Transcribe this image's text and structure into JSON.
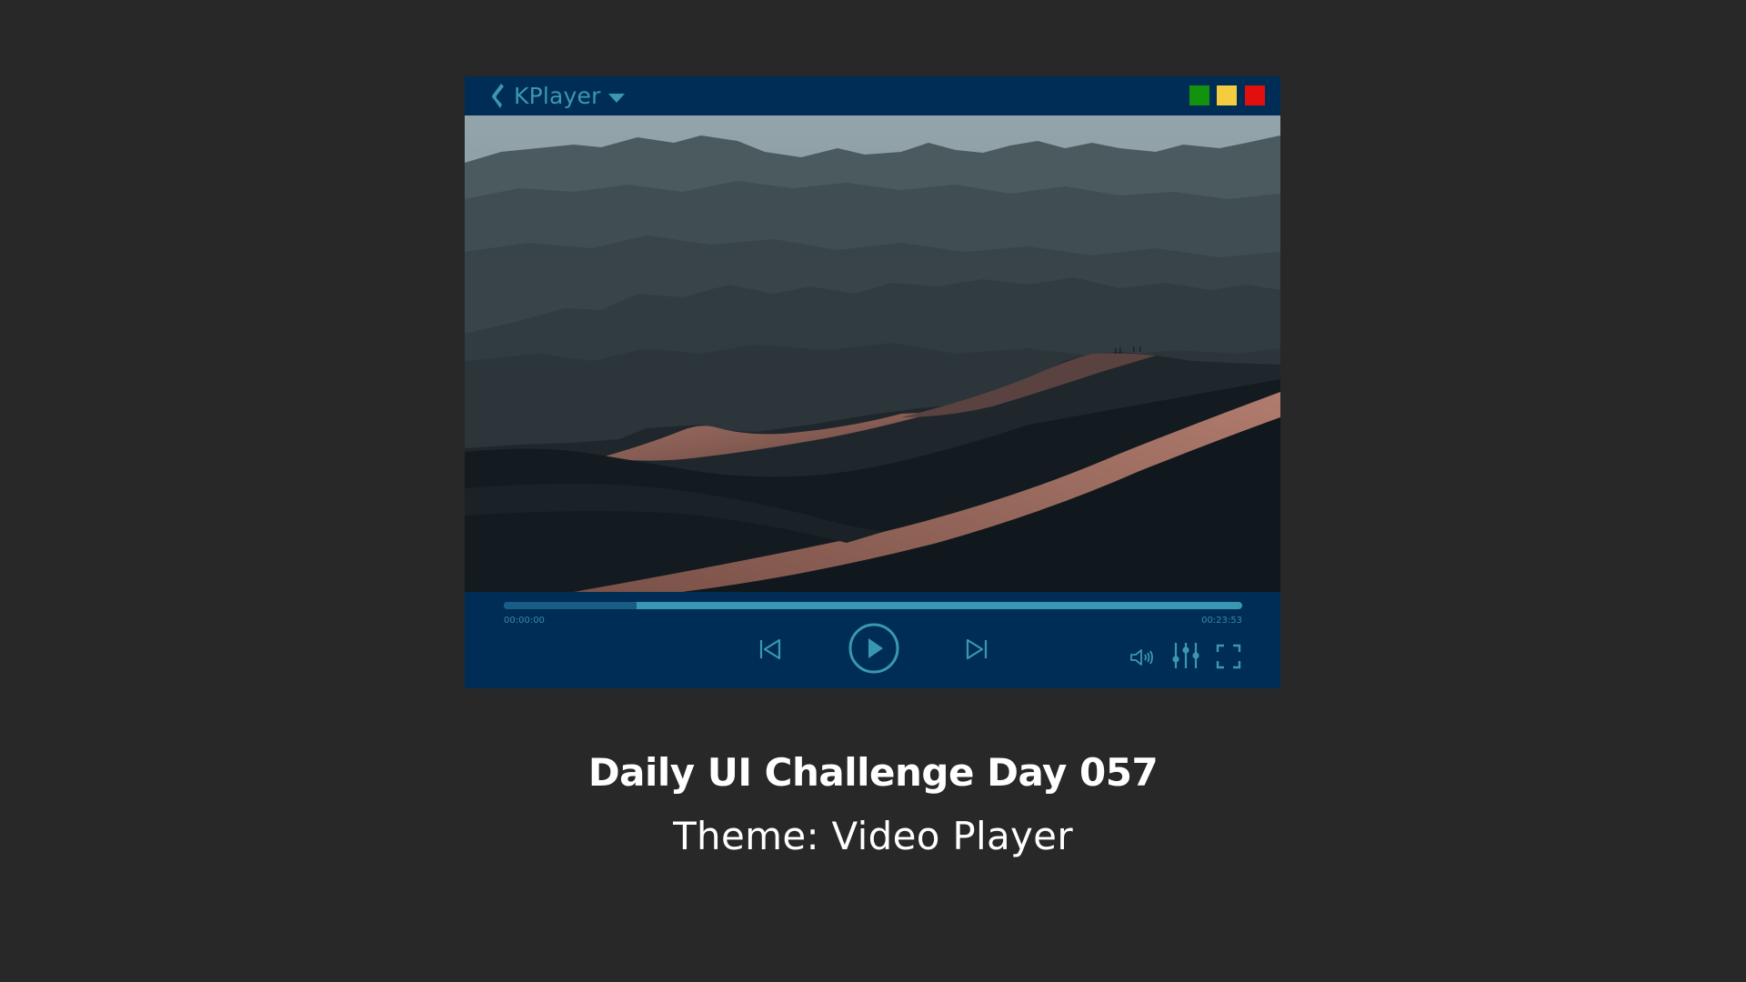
{
  "app": {
    "name": "KPlayer",
    "logo_icon": "kplayer-logo-icon",
    "menu_icon": "caret-down-icon"
  },
  "window_controls": [
    {
      "name": "maximize-button",
      "color": "#12920f"
    },
    {
      "name": "minimize-button",
      "color": "#f5cb3f"
    },
    {
      "name": "close-button",
      "color": "#e30e0e"
    }
  ],
  "video": {
    "content": "desert-dunes-landscape"
  },
  "playback": {
    "current_time": "00:00:00",
    "total_time": "00:23:53",
    "buffered_fraction": 0.18
  },
  "controls": {
    "previous_icon": "skip-previous-icon",
    "play_icon": "play-circle-icon",
    "next_icon": "skip-next-icon",
    "volume_icon": "volume-icon",
    "equalizer_icon": "equalizer-icon",
    "fullscreen_icon": "fullscreen-icon"
  },
  "colors": {
    "player_bg": "#002d56",
    "accent": "#3a97b4",
    "progress_fill": "#175d86",
    "page_bg": "#282828"
  },
  "caption": {
    "title": "Daily UI Challenge Day 057",
    "subtitle": "Theme: Video Player"
  }
}
